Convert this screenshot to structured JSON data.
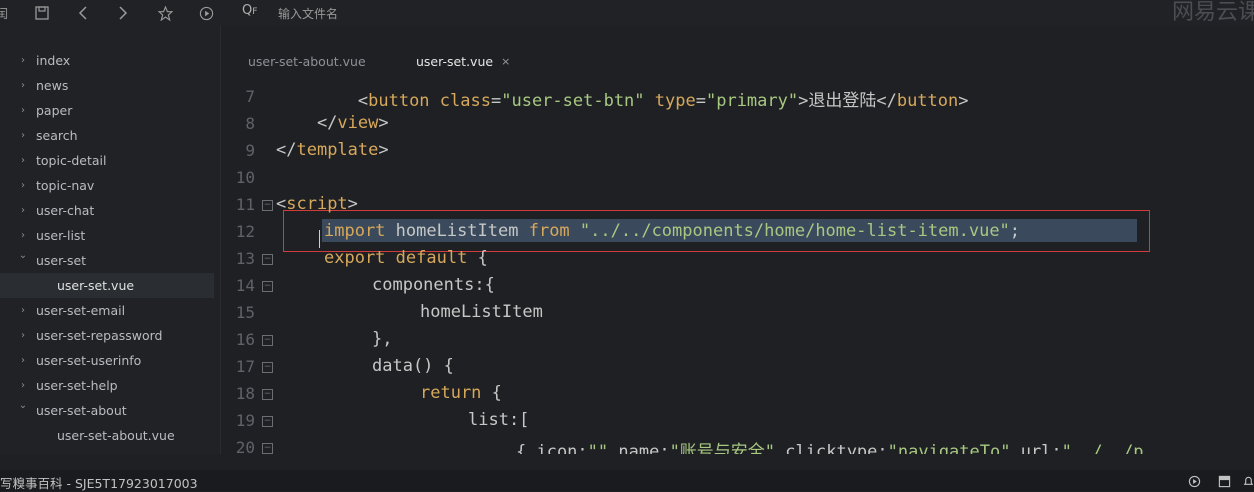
{
  "toolbar": {
    "partial_left": "闰",
    "search_prefix": "Q",
    "search_sub": "F",
    "search_placeholder": "输入文件名",
    "brand_text": "网易云课"
  },
  "sidebar": {
    "items": [
      {
        "label": "index",
        "arrow": "›"
      },
      {
        "label": "news",
        "arrow": "›"
      },
      {
        "label": "paper",
        "arrow": "›"
      },
      {
        "label": "search",
        "arrow": "›"
      },
      {
        "label": "topic-detail",
        "arrow": "›"
      },
      {
        "label": "topic-nav",
        "arrow": "›"
      },
      {
        "label": "user-chat",
        "arrow": "›"
      },
      {
        "label": "user-list",
        "arrow": "›"
      },
      {
        "label": "user-set",
        "arrow": "⌄"
      },
      {
        "label": "user-set.vue",
        "arrow": ""
      },
      {
        "label": "user-set-email",
        "arrow": "›"
      },
      {
        "label": "user-set-repassword",
        "arrow": "›"
      },
      {
        "label": "user-set-userinfo",
        "arrow": "›"
      },
      {
        "label": "user-set-help",
        "arrow": "›"
      },
      {
        "label": "user-set-about",
        "arrow": "⌄"
      },
      {
        "label": "user-set-about.vue",
        "arrow": ""
      }
    ]
  },
  "tabs": [
    {
      "label": "user-set-about.vue"
    },
    {
      "label": "user-set.vue",
      "close": "×"
    }
  ],
  "editor": {
    "line_numbers": [
      "7",
      "8",
      "9",
      "10",
      "11",
      "12",
      "13",
      "14",
      "15",
      "16",
      "17",
      "18",
      "19",
      "20"
    ],
    "lines": {
      "l7a": "        <",
      "l7tag": "button",
      "l7b": " ",
      "l7attr1": "class",
      "l7c": "=",
      "l7str1": "\"user-set-btn\"",
      "l7d": " ",
      "l7attr2": "type",
      "l7e": "=",
      "l7str2": "\"primary\"",
      "l7f": ">退出登陆</",
      "l7tag2": "button",
      "l7g": ">",
      "l8a": "    </",
      "l8tag": "view",
      "l8b": ">",
      "l9a": "</",
      "l9tag": "template",
      "l9b": ">",
      "l11a": "<",
      "l11tag": "script",
      "l11b": ">",
      "l12kw": "import",
      "l12a": " homeListItem ",
      "l12kw2": "from",
      "l12b": " ",
      "l12str": "\"../../components/home/home-list-item.vue\"",
      "l12c": ";",
      "l13kw": "export",
      "l13a": " ",
      "l13kw2": "default",
      "l13b": " {",
      "l14a": "components:{",
      "l15a": "homeListItem",
      "l16a": "},",
      "l17a": "data() {",
      "l18kw": "return",
      "l18a": " {",
      "l19a": "list:[",
      "l20a": "{ icon:",
      "l20str1": "\"\"",
      "l20b": ",name:",
      "l20str2": "\"账号与安全\"",
      "l20c": ",clicktype:",
      "l20str3": "\"navigateTo\"",
      "l20d": ",url:",
      "l20str4": "\"../../p"
    }
  },
  "status": {
    "text": "写糗事百科 - SJE5T17923017003"
  }
}
